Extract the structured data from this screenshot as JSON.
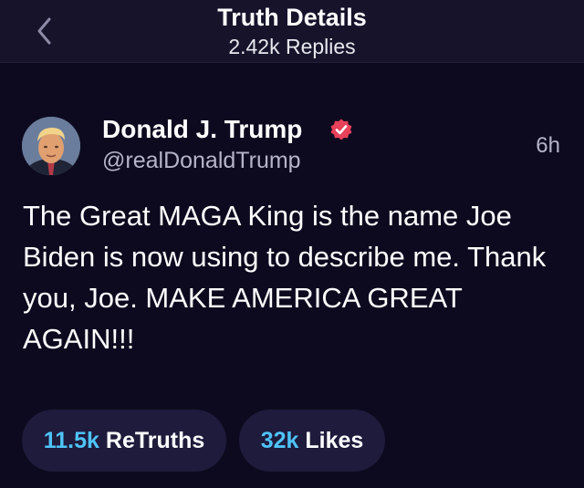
{
  "header": {
    "title": "Truth Details",
    "subtitle": "2.42k Replies",
    "back_icon": "chevron-left-icon"
  },
  "post": {
    "author_name": "Donald J. Trump",
    "author_handle": "@realDonaldTrump",
    "verified_icon": "verified-badge-icon",
    "time": "6h",
    "body": "The Great MAGA King is the name Joe Biden is now using to describe me. Thank you, Joe. MAKE AMERICA GREAT AGAIN!!!"
  },
  "stats": {
    "retruths_count": "11.5k",
    "retruths_label": "ReTruths",
    "likes_count": "32k",
    "likes_label": "Likes"
  },
  "colors": {
    "background": "#0d0a1f",
    "header_bg": "#16132b",
    "pill_bg": "#1e1b3c",
    "accent_count": "#4fc3f7",
    "verified": "#e8415a"
  }
}
